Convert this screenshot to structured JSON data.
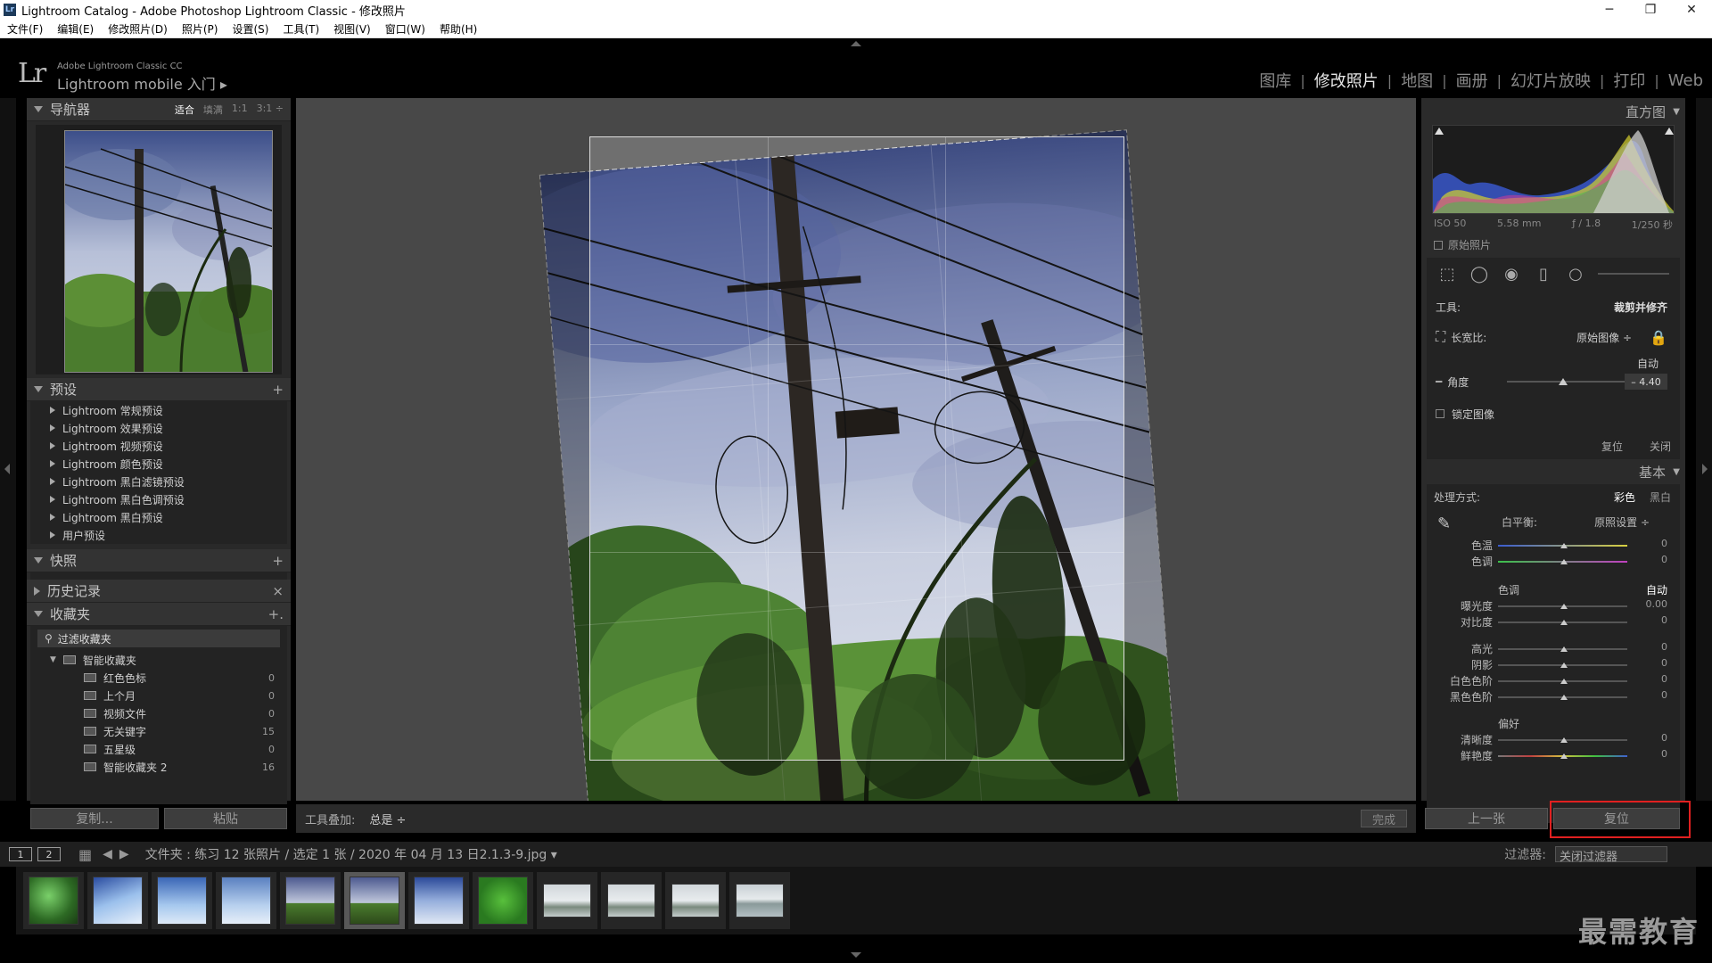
{
  "window": {
    "title": "Lightroom Catalog - Adobe Photoshop Lightroom Classic - 修改照片",
    "icon": "Lr",
    "controls": [
      "─",
      "❐",
      "✕"
    ]
  },
  "menu": [
    "文件(F)",
    "编辑(E)",
    "修改照片(D)",
    "照片(P)",
    "设置(S)",
    "工具(T)",
    "视图(V)",
    "窗口(W)",
    "帮助(H)"
  ],
  "identity": {
    "logo": "Lr",
    "line1": "Adobe Lightroom Classic CC",
    "line2": "Lightroom mobile 入门 ▸"
  },
  "modules": [
    {
      "label": "图库",
      "active": false
    },
    {
      "label": "修改照片",
      "active": true
    },
    {
      "label": "地图",
      "active": false
    },
    {
      "label": "画册",
      "active": false
    },
    {
      "label": "幻灯片放映",
      "active": false
    },
    {
      "label": "打印",
      "active": false
    },
    {
      "label": "Web",
      "active": false
    }
  ],
  "navigator": {
    "title": "导航器",
    "modes": [
      "适合",
      "填满",
      "1:1",
      "3:1 ÷"
    ]
  },
  "presets": {
    "title": "预设",
    "add": "+",
    "items": [
      "Lightroom 常规预设",
      "Lightroom 效果预设",
      "Lightroom 视频预设",
      "Lightroom 颜色预设",
      "Lightroom 黑白滤镜预设",
      "Lightroom 黑白色调预设",
      "Lightroom 黑白预设",
      "用户预设"
    ]
  },
  "snapshots": {
    "title": "快照",
    "add": "+"
  },
  "history": {
    "title": "历史记录",
    "clear": "×"
  },
  "collections": {
    "title": "收藏夹",
    "add": "+.",
    "filter": "过滤收藏夹",
    "smart": "智能收藏夹",
    "items": [
      {
        "name": "红色色标",
        "count": "0"
      },
      {
        "name": "上个月",
        "count": "0"
      },
      {
        "name": "视频文件",
        "count": "0"
      },
      {
        "name": "无关键字",
        "count": "15"
      },
      {
        "name": "五星级",
        "count": "0"
      },
      {
        "name": "智能收藏夹 2",
        "count": "16"
      }
    ]
  },
  "left_buttons": {
    "copy": "复制...",
    "paste": "粘贴"
  },
  "toolbar": {
    "overlay_label": "工具叠加:",
    "overlay_value": "总是 ÷",
    "done": "完成"
  },
  "histogram": {
    "title": "直方图",
    "exif": [
      "ISO 50",
      "5.58 mm",
      "ƒ / 1.8",
      "1/250 秒"
    ],
    "original": "原始照片"
  },
  "crop": {
    "tool_label": "工具:",
    "tool_name": "裁剪并修齐",
    "aspect_label": "长宽比:",
    "aspect_value": "原始图像 ÷",
    "auto": "自动",
    "angle_label": "角度",
    "angle_value": "– 4.40",
    "angle": -4.4,
    "lock": "锁定图像",
    "reset": "复位",
    "close": "关闭"
  },
  "basic": {
    "title": "基本",
    "treatment_label": "处理方式:",
    "color": "彩色",
    "bw": "黑白",
    "wb_label": "白平衡:",
    "wb_value": "原照设置 ÷",
    "rows_wb": [
      {
        "label": "色温",
        "value": "0"
      },
      {
        "label": "色调",
        "value": "0"
      }
    ],
    "tone_title": "色调",
    "tone_auto": "自动",
    "rows_tone": [
      {
        "label": "曝光度",
        "value": "0.00"
      },
      {
        "label": "对比度",
        "value": "0"
      }
    ],
    "rows_light": [
      {
        "label": "高光",
        "value": "0"
      },
      {
        "label": "阴影",
        "value": "0"
      },
      {
        "label": "白色色阶",
        "value": "0"
      },
      {
        "label": "黑色色阶",
        "value": "0"
      }
    ],
    "presence_title": "偏好",
    "rows_presence": [
      {
        "label": "清晰度",
        "value": "0"
      },
      {
        "label": "鲜艳度",
        "value": "0"
      }
    ]
  },
  "right_buttons": {
    "prev": "上一张",
    "reset": "复位"
  },
  "filmbar": {
    "page1": "1",
    "page2": "2",
    "path": "文件夹 : 练习    12 张照片 / 选定 1 张 / 2020 年 04 月 13 日2.1.3-9.jpg ▾",
    "filter_label": "过滤器:",
    "filter_value": "关闭过滤器"
  },
  "thumbnails": [
    {
      "kind": "leaves",
      "selected": false
    },
    {
      "kind": "sky-branch",
      "selected": false
    },
    {
      "kind": "sky-branch2",
      "selected": false
    },
    {
      "kind": "sky-branch3",
      "selected": false
    },
    {
      "kind": "pole",
      "selected": false
    },
    {
      "kind": "pole",
      "selected": true
    },
    {
      "kind": "clouds",
      "selected": false
    },
    {
      "kind": "green",
      "selected": false
    },
    {
      "kind": "snow",
      "selected": false
    },
    {
      "kind": "snow",
      "selected": false
    },
    {
      "kind": "snow",
      "selected": false
    },
    {
      "kind": "snow-river",
      "selected": false
    }
  ],
  "watermark": "最需教育"
}
